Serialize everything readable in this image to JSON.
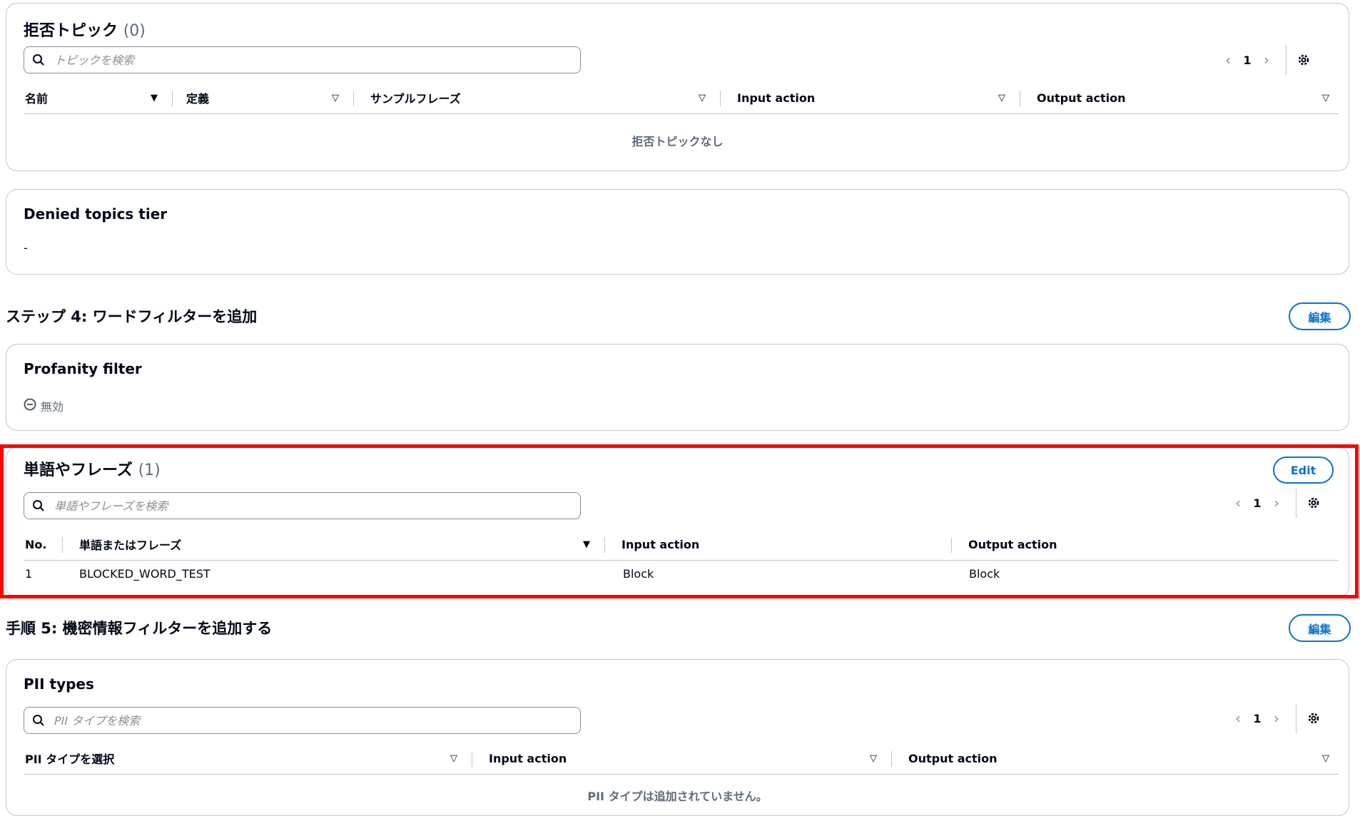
{
  "denied_topics": {
    "title": "拒否トピック",
    "count": "(0)",
    "search_placeholder": "トピックを検索",
    "page": "1",
    "columns": [
      "名前",
      "定義",
      "サンプルフレーズ",
      "Input action",
      "Output action"
    ],
    "empty_text": "拒否トピックなし"
  },
  "denied_topics_tier": {
    "label": "Denied topics tier",
    "value": "-"
  },
  "step4": {
    "title": "ステップ 4: ワードフィルターを追加",
    "edit_label": "編集"
  },
  "profanity": {
    "label": "Profanity filter",
    "status": "無効"
  },
  "words": {
    "title": "単語やフレーズ",
    "count": "(1)",
    "edit_label": "Edit",
    "search_placeholder": "単語やフレーズを検索",
    "page": "1",
    "columns": [
      "No.",
      "単語またはフレーズ",
      "Input action",
      "Output action"
    ],
    "rows": [
      {
        "no": "1",
        "word": "BLOCKED_WORD_TEST",
        "input": "Block",
        "output": "Block"
      }
    ]
  },
  "step5": {
    "title": "手順 5: 機密情報フィルターを追加する",
    "edit_label": "編集"
  },
  "pii": {
    "title": "PII types",
    "search_placeholder": "PII タイプを検索",
    "page": "1",
    "columns": [
      "PII タイプを選択",
      "Input action",
      "Output action"
    ],
    "empty_text": "PII タイプは追加されていません。"
  },
  "colors": {
    "accent": "#0972d3",
    "highlight": "#ff0000",
    "border": "#c6c6cd",
    "muted": "#5f6b7a"
  }
}
